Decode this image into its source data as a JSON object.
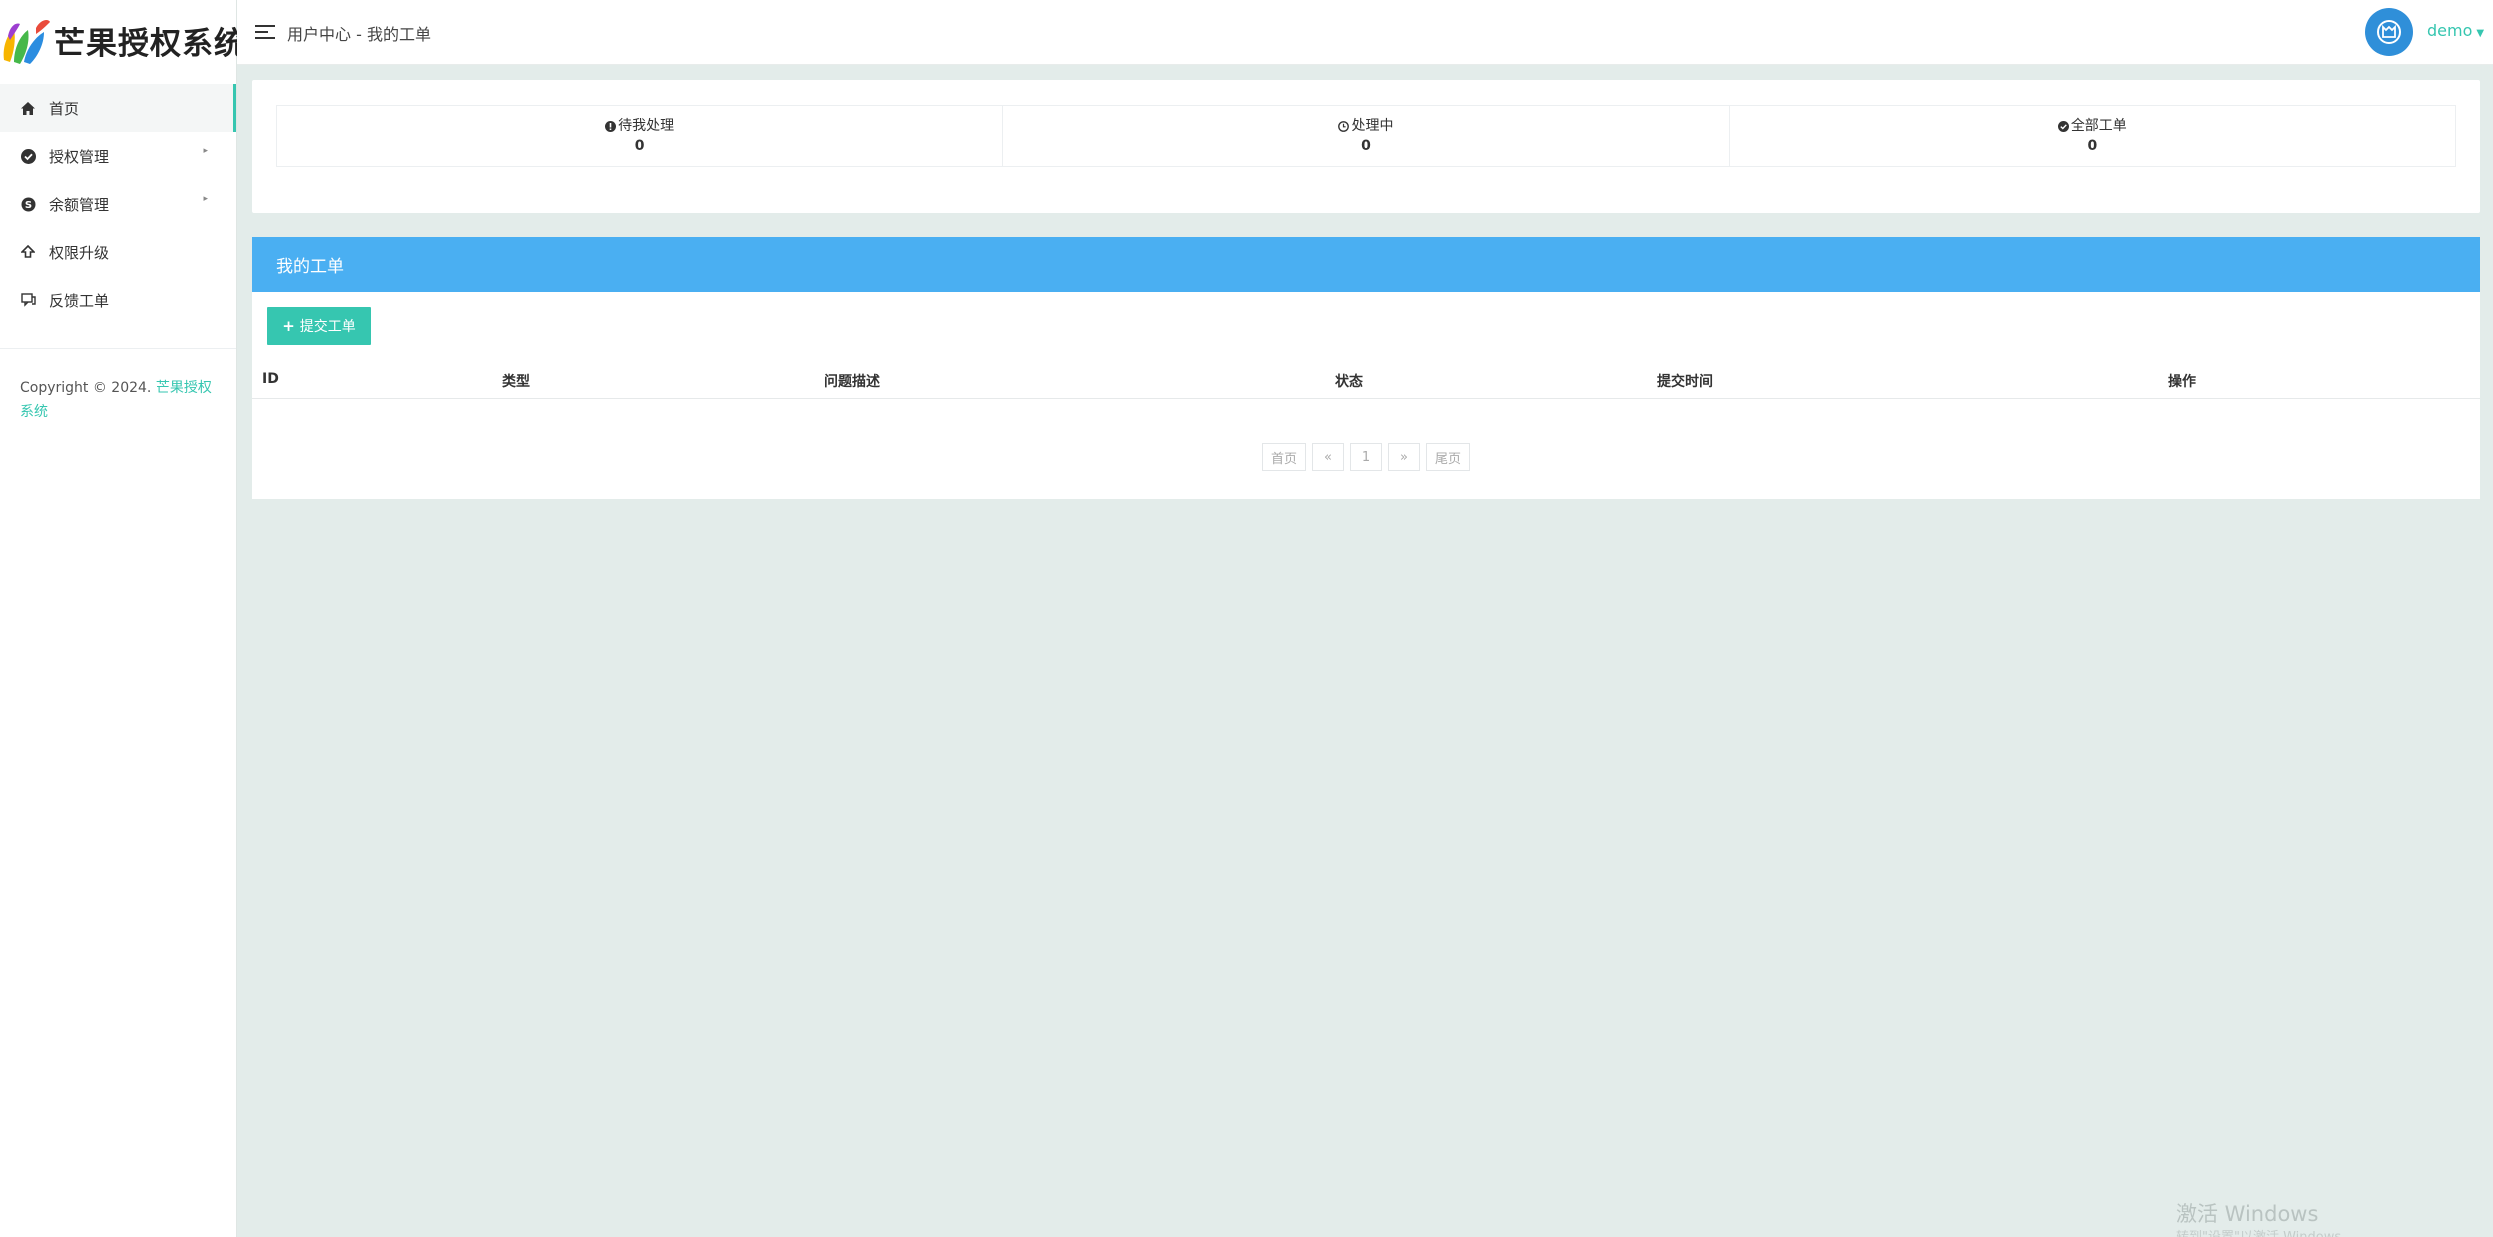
{
  "brand": {
    "name": "芒果授权系统"
  },
  "sidebar": {
    "items": [
      {
        "label": "首页",
        "icon": "home-icon",
        "active": true,
        "has_submenu": false
      },
      {
        "label": "授权管理",
        "icon": "check-circle-icon",
        "active": false,
        "has_submenu": true
      },
      {
        "label": "余额管理",
        "icon": "skype-icon",
        "active": false,
        "has_submenu": true
      },
      {
        "label": "权限升级",
        "icon": "upgrade-icon",
        "active": false,
        "has_submenu": false
      },
      {
        "label": "反馈工单",
        "icon": "feedback-icon",
        "active": false,
        "has_submenu": false
      }
    ],
    "copyright_prefix": "Copyright © 2024. ",
    "copyright_link": "芒果授权系统"
  },
  "header": {
    "breadcrumb": "用户中心 - 我的工单",
    "user_name": "demo"
  },
  "stats": [
    {
      "label": "待我处理",
      "value": "0",
      "icon": "exclamation-circle-icon"
    },
    {
      "label": "处理中",
      "value": "0",
      "icon": "clock-icon"
    },
    {
      "label": "全部工单",
      "value": "0",
      "icon": "check-circle-icon"
    }
  ],
  "tickets": {
    "title": "我的工单",
    "submit_label": "提交工单",
    "columns": [
      "ID",
      "类型",
      "问题描述",
      "状态",
      "提交时间",
      "操作"
    ],
    "rows": [],
    "pagination": [
      "首页",
      "«",
      "1",
      "»",
      "尾页"
    ]
  },
  "watermark": {
    "title": "激活 Windows",
    "subtitle": "转到\"设置\"以激活 Windows。"
  },
  "colors": {
    "accent": "#36c6b0",
    "panel_header": "#4aaff2",
    "avatar": "#2f8fd9",
    "background": "#e3ecea"
  }
}
